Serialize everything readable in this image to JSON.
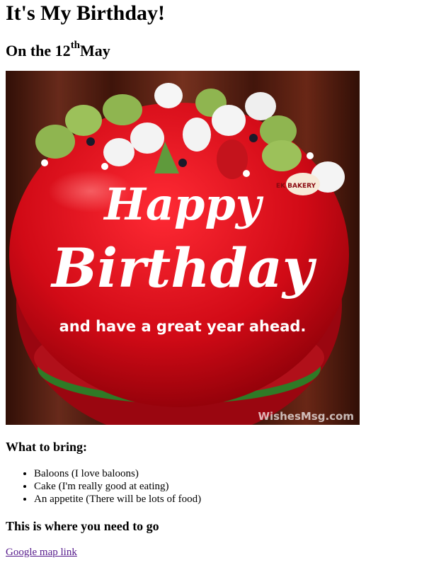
{
  "heading": "It's My Birthday!",
  "date": {
    "prefix": "On the 12",
    "suffix": "th",
    "month": "May"
  },
  "image": {
    "line1": "Happy",
    "line2": "Birthday",
    "line3": "and have a great year ahead.",
    "watermark": "WishesMsg.com",
    "plaque": "EK BAKERY",
    "colors": {
      "frosting": "#d10a16",
      "background": "#5a2416",
      "text": "#ffffff",
      "meringue_green": "#8fb550"
    }
  },
  "bring": {
    "title": "What to bring:",
    "items": [
      "Baloons (I love baloons)",
      "Cake (I'm really good at eating)",
      "An appetite (There will be lots of food)"
    ]
  },
  "go": {
    "title": "This is where you need to go",
    "link_text": "Google map link"
  }
}
